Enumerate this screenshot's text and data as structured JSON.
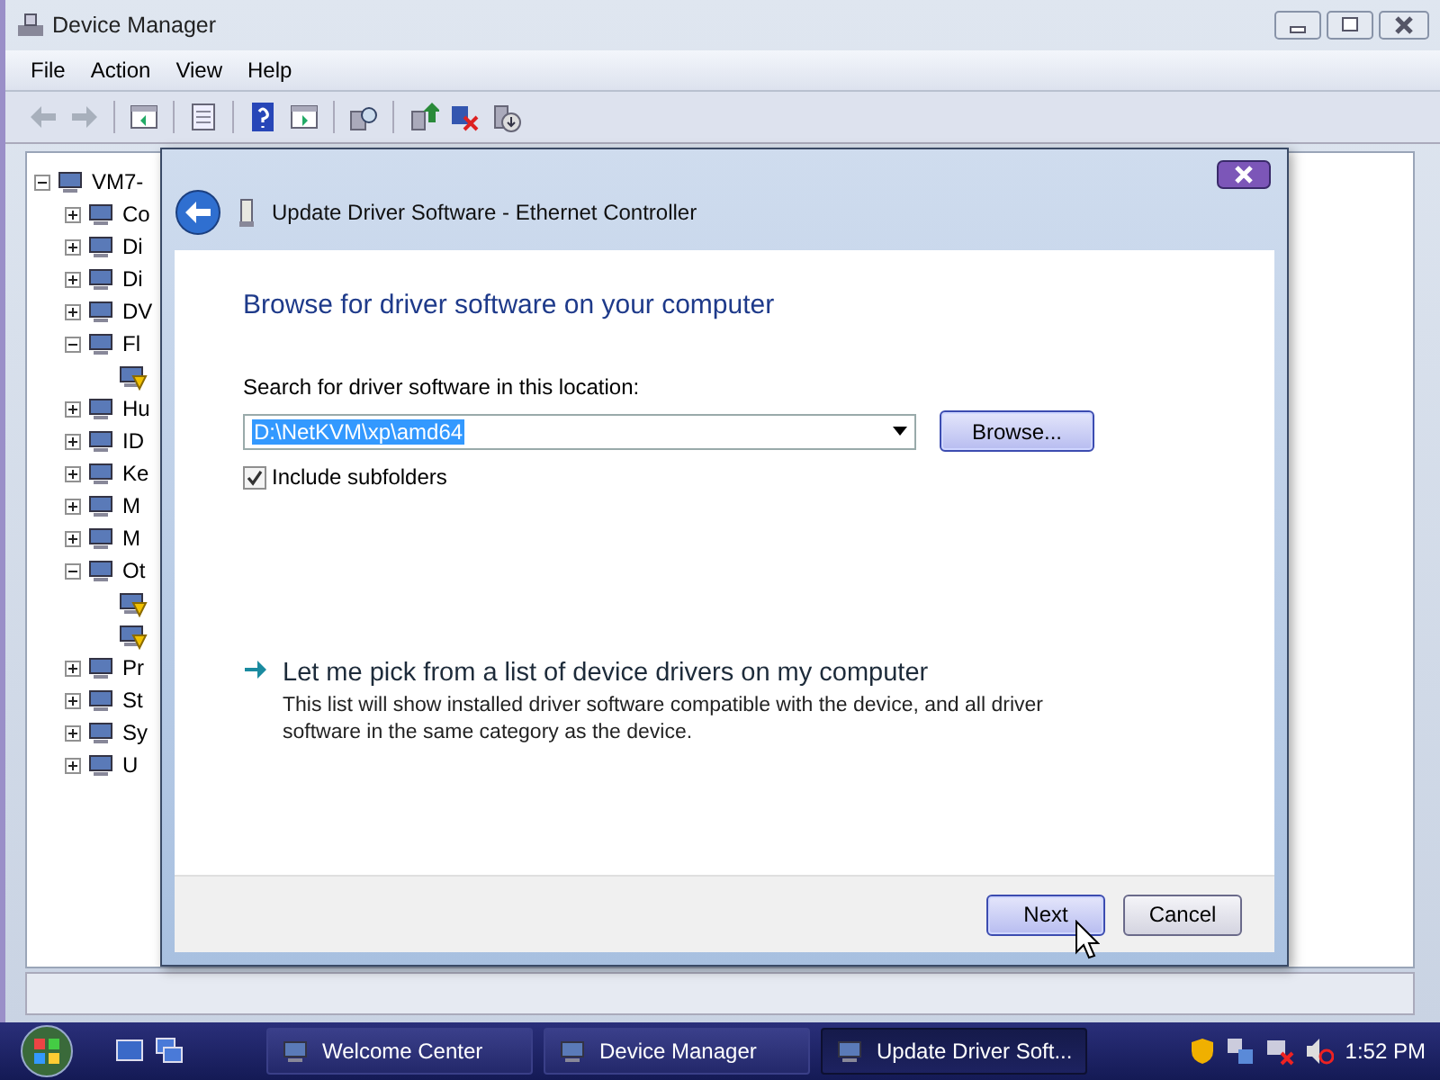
{
  "window": {
    "title": "Device Manager"
  },
  "menu": [
    "File",
    "Action",
    "View",
    "Help"
  ],
  "tree": [
    {
      "label": "VM7-",
      "expanded": true,
      "warning": false,
      "children": [
        {
          "label": "Co",
          "expanded": false,
          "warning": false
        },
        {
          "label": "Di",
          "expanded": false,
          "warning": false
        },
        {
          "label": "Di",
          "expanded": false,
          "warning": false
        },
        {
          "label": "DV",
          "expanded": false,
          "warning": false
        },
        {
          "label": "Fl",
          "expanded": true,
          "warning": false,
          "children": [
            {
              "warning": true
            }
          ]
        },
        {
          "label": "Hu",
          "expanded": false,
          "warning": false
        },
        {
          "label": "ID",
          "expanded": false,
          "warning": false
        },
        {
          "label": "Ke",
          "expanded": false,
          "warning": false
        },
        {
          "label": "M",
          "expanded": false,
          "warning": false
        },
        {
          "label": "M",
          "expanded": false,
          "warning": false
        },
        {
          "label": "Ot",
          "expanded": true,
          "warning": false,
          "children": [
            {
              "warning": true
            },
            {
              "warning": true
            }
          ]
        },
        {
          "label": "Pr",
          "expanded": false,
          "warning": false
        },
        {
          "label": "St",
          "expanded": false,
          "warning": false
        },
        {
          "label": "Sy",
          "expanded": false,
          "warning": false
        },
        {
          "label": "U",
          "expanded": false,
          "warning": false
        }
      ]
    }
  ],
  "dialog": {
    "title": "Update Driver Software - Ethernet Controller",
    "heading": "Browse for driver software on your computer",
    "location_label": "Search for driver software in this location:",
    "location": {
      "value": "D:\\NetKVM\\xp\\amd64",
      "selected": true
    },
    "browse_button": "Browse...",
    "include_subfolders": {
      "label": "Include subfolders",
      "checked": true
    },
    "option": {
      "title": "Let me pick from a list of device drivers on my computer",
      "description": "This list will show installed driver software compatible with the device, and all driver software in the same category as the device."
    },
    "buttons": [
      {
        "label": "Next",
        "default": true
      },
      {
        "label": "Cancel",
        "default": false
      }
    ]
  },
  "taskbar": {
    "tasks": [
      {
        "label": "Welcome Center",
        "selected": false
      },
      {
        "label": "Device Manager",
        "selected": false
      },
      {
        "label": "Update Driver Soft...",
        "selected": true
      }
    ],
    "clock": "1:52 PM"
  }
}
